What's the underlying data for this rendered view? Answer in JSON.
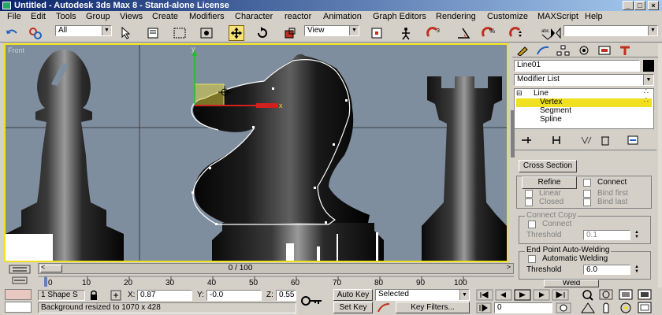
{
  "window": {
    "title": "Untitled - Autodesk 3ds Max 8 - Stand-alone License",
    "minimize": "_",
    "maximize": "□",
    "close": "×"
  },
  "menu": [
    "File",
    "Edit",
    "Tools",
    "Group",
    "Views",
    "Create",
    "Modifiers",
    "Character",
    "reactor",
    "Animation",
    "Graph Editors",
    "Rendering",
    "Customize",
    "MAXScript",
    "Help"
  ],
  "toolbar": {
    "selection_filter": "All",
    "reference_coord": "View",
    "named_selection": ""
  },
  "viewport": {
    "label": "Front",
    "frame_counter": "0 / 100",
    "gizmo_axis_y": "y",
    "gizmo_axis_x": "x",
    "colors": {
      "border": "#f0e020",
      "background": "#7f8e9e",
      "spline": "#ffffff"
    }
  },
  "command_panel": {
    "object_name": "Line01",
    "modifier_list": "Modifier List",
    "stack": [
      {
        "label": "Line",
        "level": 0,
        "selected": false
      },
      {
        "label": "Vertex",
        "level": 1,
        "selected": true
      },
      {
        "label": "Segment",
        "level": 1,
        "selected": false
      },
      {
        "label": "Spline",
        "level": 1,
        "selected": false
      }
    ],
    "cross_section": "Cross Section",
    "refine": "Refine",
    "connect": "Connect",
    "linear": "Linear",
    "bind_first": "Bind first",
    "closed": "Closed",
    "bind_last": "Bind last",
    "connect_copy_title": "Connect Copy",
    "connect_copy_connect": "Connect",
    "threshold_label": "Threshold",
    "threshold_value_1": "0.1",
    "end_point_title": "End Point Auto-Welding",
    "automatic_welding": "Automatic Welding",
    "threshold_value_2": "6.0",
    "weld": "Weld"
  },
  "timeline": {
    "ticks": [
      "0",
      "10",
      "20",
      "30",
      "40",
      "50",
      "60",
      "70",
      "80",
      "90",
      "100"
    ]
  },
  "status": {
    "selection": "1 Shape S",
    "x_label": "X:",
    "x_value": "0.87",
    "y_label": "Y:",
    "y_value": "-0.0",
    "z_label": "Z:",
    "z_value": "0.55",
    "prompt": "Background resized to 1070 x 428",
    "auto_key": "Auto Key",
    "set_key": "Set Key",
    "key_mode": "Selected",
    "key_filters": "Key Filters...",
    "frame": "0"
  }
}
